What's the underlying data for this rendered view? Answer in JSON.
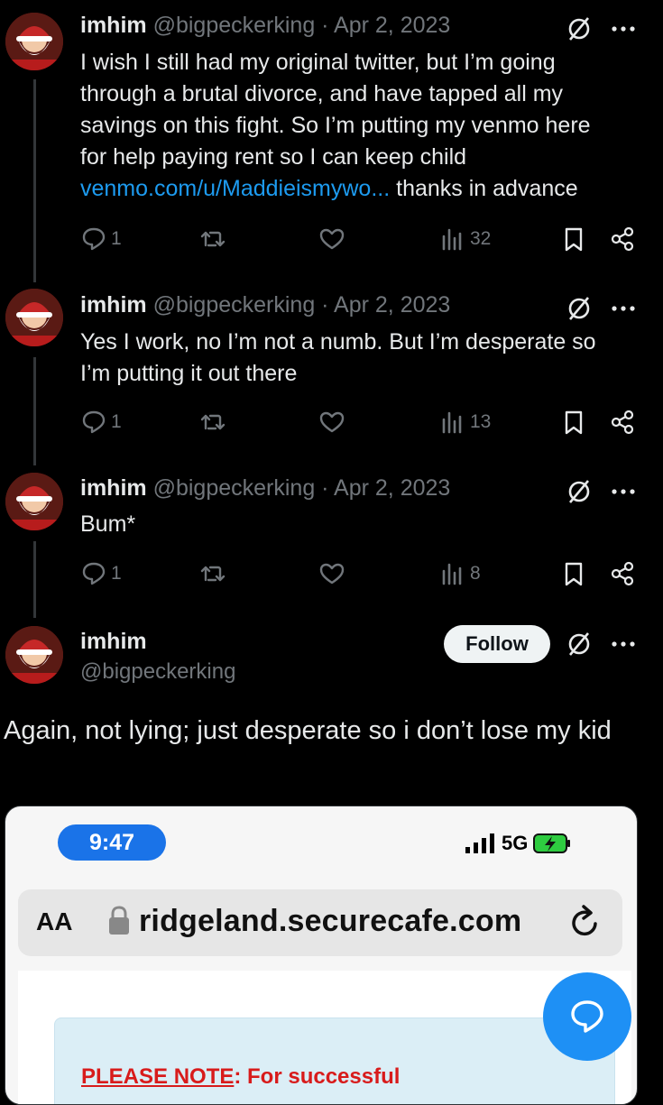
{
  "replies": [
    {
      "name": "imhim",
      "handle_date": "@bigpeckerking · Apr 2, 2023",
      "text_lines": [
        "I wish I still had my original twitter, but I’m going",
        "through a brutal divorce, and have tapped all my",
        "savings on this fight. So I’m putting my venmo here",
        "for help paying rent so I can keep child"
      ],
      "link": "venmo.com/u/Maddieismywo...",
      "link_tail": " thanks in advance",
      "reply_count": "1",
      "views": "32"
    },
    {
      "name": "imhim",
      "handle_date": "@bigpeckerking · Apr 2, 2023",
      "text_lines": [
        "Yes I work,  no I’m not a numb. But I’m desperate so",
        "I’m putting it out there"
      ],
      "reply_count": "1",
      "views": "13"
    },
    {
      "name": "imhim",
      "handle_date": "@bigpeckerking · Apr 2, 2023",
      "text_lines": [
        "Bum*"
      ],
      "reply_count": "1",
      "views": "8"
    }
  ],
  "main_tweet": {
    "name": "imhim",
    "handle": "@bigpeckerking",
    "follow_label": "Follow",
    "text": "Again, not lying; just desperate so i don’t lose my kid"
  },
  "embedded_screenshot": {
    "time": "9:47",
    "network": "5G",
    "aa_label": "AA",
    "url": "ridgeland.securecafe.com",
    "notice_label": "PLEASE NOTE",
    "notice_text": ": For successful"
  },
  "colors": {
    "link": "#1d9bf0",
    "muted": "#71767b",
    "time_pill": "#1a73e8",
    "notice": "#d81b1b"
  }
}
